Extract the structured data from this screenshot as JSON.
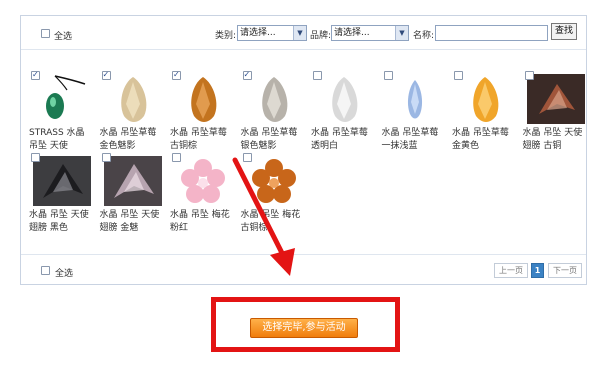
{
  "toolbar": {
    "select_all_label": "全选",
    "category_label": "类别:",
    "category_value": "请选择...",
    "brand_label": "品牌:",
    "brand_value": "请选择...",
    "name_label": "名称:",
    "name_value": "",
    "search_label": "查找"
  },
  "products": [
    {
      "name": "STRASS 水晶吊坠 天使",
      "checked": true
    },
    {
      "name": "水晶 吊坠草莓 金色魅影",
      "checked": true
    },
    {
      "name": "水晶 吊坠草莓 古铜棕",
      "checked": true
    },
    {
      "name": "水晶 吊坠草莓 银色魅影",
      "checked": true
    },
    {
      "name": "水晶 吊坠草莓 透明白",
      "checked": false
    },
    {
      "name": "水晶 吊坠草莓 一抹浅蓝",
      "checked": false
    },
    {
      "name": "水晶 吊坠草莓 金黄色",
      "checked": false
    },
    {
      "name": "水晶 吊坠 天使翅膀 古铜",
      "checked": false
    },
    {
      "name": "水晶 吊坠 天使翅膀 黑色",
      "checked": false
    },
    {
      "name": "水晶 吊坠 天使翅膀 金魅",
      "checked": false
    },
    {
      "name": "水晶 吊坠 梅花 粉红",
      "checked": false
    },
    {
      "name": "水晶 吊坠 梅花 古铜棕",
      "checked": false
    }
  ],
  "footer": {
    "select_all_label": "全选",
    "prev_label": "上一页",
    "page_number": "1",
    "next_label": "下一页"
  },
  "submit": {
    "label": "选择完毕,参与活动"
  },
  "colors": {
    "accent_orange": "#f07d0c",
    "highlight_red": "#e31414",
    "page_current": "#3b82c4"
  }
}
